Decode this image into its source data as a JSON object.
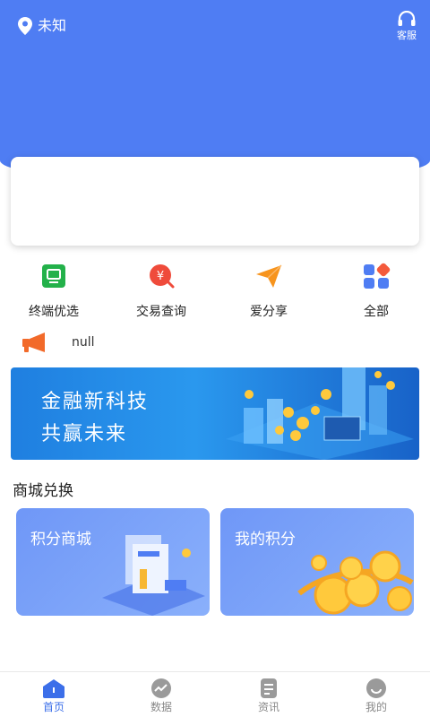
{
  "header": {
    "location": "未知",
    "service_label": "客服"
  },
  "colors": {
    "primary": "#4f7df3",
    "tab_active": "#3c6fe9",
    "tab_inactive": "#9a9a9a"
  },
  "quick_menu": [
    {
      "label": "终端优选",
      "icon": "monitor-icon",
      "color": "#23b14a"
    },
    {
      "label": "交易查询",
      "icon": "yuan-coin-search-icon",
      "color": "#ef4b3b"
    },
    {
      "label": "爱分享",
      "icon": "paper-plane-icon",
      "color": "#f7941d"
    },
    {
      "label": "全部",
      "icon": "apps-icon",
      "color": "#4f7df3"
    }
  ],
  "notice": {
    "icon": "megaphone-icon",
    "text": "null"
  },
  "banner": {
    "line1": "金融新科技",
    "line2": "共赢未来"
  },
  "mall": {
    "title": "商城兑换",
    "cards": [
      {
        "title": "积分商城",
        "icon": "points-mall-illustration"
      },
      {
        "title": "我的积分",
        "icon": "gold-coins-illustration"
      }
    ]
  },
  "tabbar": [
    {
      "label": "首页",
      "icon": "home-icon",
      "active": true
    },
    {
      "label": "数据",
      "icon": "chart-icon",
      "active": false
    },
    {
      "label": "资讯",
      "icon": "document-icon",
      "active": false
    },
    {
      "label": "我的",
      "icon": "profile-icon",
      "active": false
    }
  ]
}
